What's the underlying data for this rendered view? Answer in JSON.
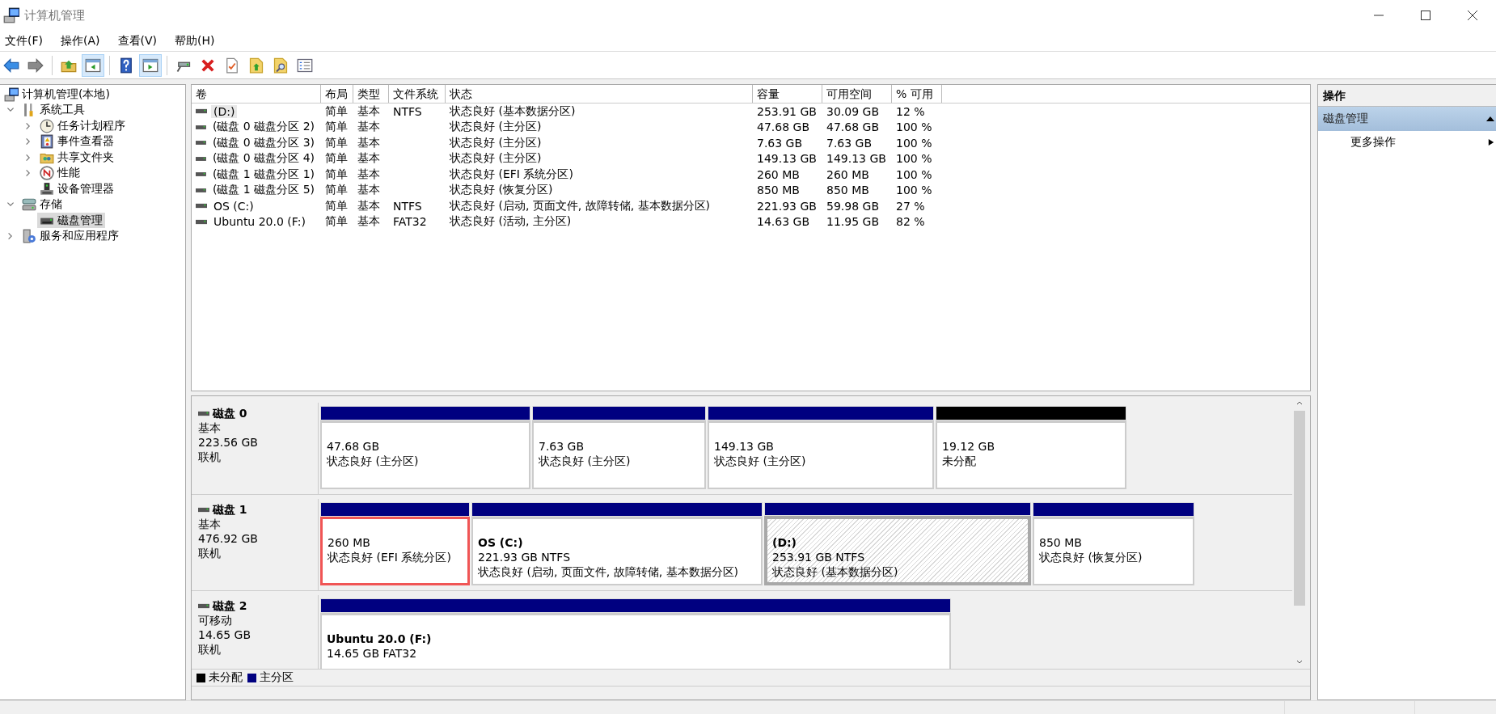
{
  "window": {
    "title": "计算机管理"
  },
  "menu": [
    "文件(F)",
    "操作(A)",
    "查看(V)",
    "帮助(H)"
  ],
  "toolbar": [
    {
      "kind": "back",
      "pressed": false
    },
    {
      "kind": "forward",
      "pressed": false
    },
    {
      "kind": "up",
      "pressed": false
    },
    {
      "kind": "tree",
      "pressed": true
    },
    {
      "kind": "help",
      "pressed": false
    },
    {
      "kind": "pane",
      "pressed": true
    },
    {
      "kind": "connect",
      "pressed": false
    },
    {
      "kind": "delete",
      "pressed": false
    },
    {
      "kind": "check",
      "pressed": false
    },
    {
      "kind": "export",
      "pressed": false
    },
    {
      "kind": "find",
      "pressed": false
    },
    {
      "kind": "props",
      "pressed": false
    }
  ],
  "tree": [
    {
      "label": "计算机管理(本地)",
      "selected": false,
      "children": [
        {
          "label": "系统工具",
          "has_children": true,
          "expanded": true,
          "selected": false,
          "children": [
            {
              "label": "任务计划程序",
              "has_children": true,
              "expanded": false,
              "selected": false
            },
            {
              "label": "事件查看器",
              "has_children": true,
              "expanded": false,
              "selected": false
            },
            {
              "label": "共享文件夹",
              "has_children": true,
              "expanded": false,
              "selected": false
            },
            {
              "label": "性能",
              "has_children": true,
              "expanded": false,
              "selected": false
            },
            {
              "label": "设备管理器",
              "has_children": false,
              "selected": false
            }
          ]
        },
        {
          "label": "存储",
          "has_children": true,
          "expanded": true,
          "selected": false,
          "children": [
            {
              "label": "磁盘管理",
              "has_children": false,
              "selected": true
            }
          ]
        },
        {
          "label": "服务和应用程序",
          "has_children": true,
          "expanded": false,
          "selected": false
        }
      ]
    }
  ],
  "table": {
    "columns": [
      "卷",
      "布局",
      "类型",
      "文件系统",
      "状态",
      "容量",
      "可用空间",
      "% 可用"
    ],
    "rows": [
      {
        "selected": true,
        "cells": [
          "(D:)",
          "简单",
          "基本",
          "NTFS",
          "状态良好 (基本数据分区)",
          "253.91 GB",
          "30.09 GB",
          "12 %"
        ]
      },
      {
        "selected": false,
        "cells": [
          "(磁盘 0 磁盘分区 2)",
          "简单",
          "基本",
          "",
          "状态良好 (主分区)",
          "47.68 GB",
          "47.68 GB",
          "100 %"
        ]
      },
      {
        "selected": false,
        "cells": [
          "(磁盘 0 磁盘分区 3)",
          "简单",
          "基本",
          "",
          "状态良好 (主分区)",
          "7.63 GB",
          "7.63 GB",
          "100 %"
        ]
      },
      {
        "selected": false,
        "cells": [
          "(磁盘 0 磁盘分区 4)",
          "简单",
          "基本",
          "",
          "状态良好 (主分区)",
          "149.13 GB",
          "149.13 GB",
          "100 %"
        ]
      },
      {
        "selected": false,
        "cells": [
          "(磁盘 1 磁盘分区 1)",
          "简单",
          "基本",
          "",
          "状态良好 (EFI 系统分区)",
          "260 MB",
          "260 MB",
          "100 %"
        ]
      },
      {
        "selected": false,
        "cells": [
          "(磁盘 1 磁盘分区 5)",
          "简单",
          "基本",
          "",
          "状态良好 (恢复分区)",
          "850 MB",
          "850 MB",
          "100 %"
        ]
      },
      {
        "selected": false,
        "cells": [
          "OS (C:)",
          "简单",
          "基本",
          "NTFS",
          "状态良好 (启动, 页面文件, 故障转储, 基本数据分区)",
          "221.93 GB",
          "59.98 GB",
          "27 %"
        ]
      },
      {
        "selected": false,
        "cells": [
          "Ubuntu 20.0 (F:)",
          "简单",
          "基本",
          "FAT32",
          "状态良好 (活动, 主分区)",
          "14.63 GB",
          "11.95 GB",
          "82 %"
        ]
      }
    ]
  },
  "disks": [
    {
      "name": "磁盘 0",
      "type": "基本",
      "size": "223.56 GB",
      "status": "联机",
      "partitions": [
        {
          "kind": "primary",
          "selected": false,
          "highlighted": false,
          "size": "47.68 GB",
          "status": "状态良好 (主分区)"
        },
        {
          "kind": "primary",
          "selected": false,
          "highlighted": false,
          "size": "7.63 GB",
          "status": "状态良好 (主分区)"
        },
        {
          "kind": "primary",
          "selected": false,
          "highlighted": false,
          "size": "149.13 GB",
          "status": "状态良好 (主分区)"
        },
        {
          "kind": "unallocated",
          "selected": false,
          "highlighted": false,
          "size": "19.12 GB",
          "status": "未分配"
        }
      ]
    },
    {
      "name": "磁盘 1",
      "type": "基本",
      "size": "476.92 GB",
      "status": "联机",
      "partitions": [
        {
          "kind": "primary",
          "selected": false,
          "highlighted": true,
          "size": "260 MB",
          "status": "状态良好 (EFI 系统分区)"
        },
        {
          "kind": "primary",
          "selected": false,
          "highlighted": false,
          "title": "OS  (C:)",
          "size": "221.93 GB NTFS",
          "status": "状态良好 (启动, 页面文件, 故障转储, 基本数据分区)"
        },
        {
          "kind": "primary",
          "selected": true,
          "highlighted": false,
          "title": "(D:)",
          "size": "253.91 GB NTFS",
          "status": "状态良好 (基本数据分区)"
        },
        {
          "kind": "primary",
          "selected": false,
          "highlighted": false,
          "size": "850 MB",
          "status": "状态良好 (恢复分区)"
        }
      ]
    },
    {
      "name": "磁盘 2",
      "type": "可移动",
      "size": "14.65 GB",
      "status": "联机",
      "partitions": [
        {
          "kind": "primary",
          "selected": false,
          "highlighted": false,
          "title": "Ubuntu 20.0  (F:)",
          "size": "14.65 GB FAT32"
        }
      ]
    }
  ],
  "legend": [
    {
      "label": "未分配",
      "color": "#000000"
    },
    {
      "label": "主分区",
      "color": "#000080"
    }
  ],
  "actions": {
    "title": "操作",
    "sections": [
      {
        "label": "磁盘管理",
        "expanded": true,
        "items": [
          "更多操作"
        ]
      }
    ]
  }
}
